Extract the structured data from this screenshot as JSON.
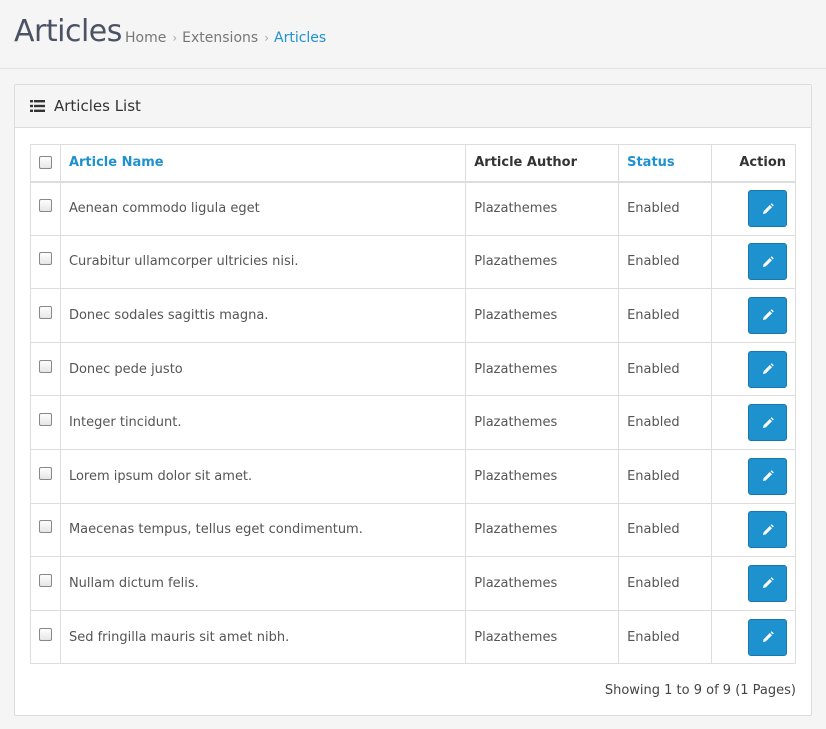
{
  "header": {
    "title": "Articles",
    "breadcrumb": [
      "Home",
      "Extensions",
      "Articles"
    ],
    "breadcrumb_separator": "›"
  },
  "panel": {
    "title": "Articles List",
    "icon": "list-icon"
  },
  "table": {
    "columns": [
      "Article Name",
      "Article Author",
      "Status",
      "Action"
    ],
    "rows": [
      {
        "name": "Aenean commodo ligula eget",
        "author": "Plazathemes",
        "status": "Enabled"
      },
      {
        "name": "Curabitur ullamcorper ultricies nisi.",
        "author": "Plazathemes",
        "status": "Enabled"
      },
      {
        "name": "Donec sodales sagittis magna.",
        "author": "Plazathemes",
        "status": "Enabled"
      },
      {
        "name": "Donec pede justo",
        "author": "Plazathemes",
        "status": "Enabled"
      },
      {
        "name": "Integer tincidunt.",
        "author": "Plazathemes",
        "status": "Enabled"
      },
      {
        "name": "Lorem ipsum dolor sit amet.",
        "author": "Plazathemes",
        "status": "Enabled"
      },
      {
        "name": "Maecenas tempus, tellus eget condimentum.",
        "author": "Plazathemes",
        "status": "Enabled"
      },
      {
        "name": "Nullam dictum felis.",
        "author": "Plazathemes",
        "status": "Enabled"
      },
      {
        "name": "Sed fringilla mauris sit amet nibh.",
        "author": "Plazathemes",
        "status": "Enabled"
      }
    ],
    "action_icon": "pencil-icon"
  },
  "pagination": {
    "summary": "Showing 1 to 9 of 9 (1 Pages)"
  },
  "colors": {
    "accent": "#1e91cf",
    "title": "#4a5263"
  }
}
